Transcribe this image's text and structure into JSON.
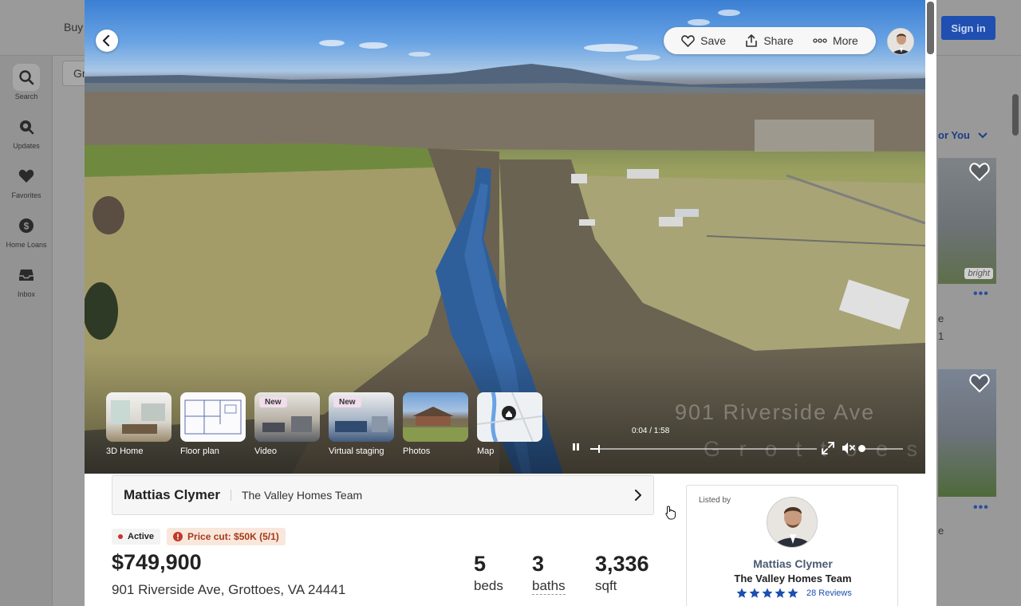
{
  "background": {
    "nav_buy": "Buy",
    "sign_in": "Sign in",
    "search_partial": "Gr",
    "for_you": "or You",
    "card_badge": "bright",
    "card_line_1": "e",
    "card_line_2": "1",
    "card_line_3": "e",
    "sidebar": [
      {
        "label": "Search",
        "icon": "search-icon"
      },
      {
        "label": "Updates",
        "icon": "updates-icon"
      },
      {
        "label": "Favorites",
        "icon": "heart-icon"
      },
      {
        "label": "Home Loans",
        "icon": "dollar-icon"
      },
      {
        "label": "Inbox",
        "icon": "inbox-icon"
      }
    ]
  },
  "toolbar": {
    "save": "Save",
    "share": "Share",
    "more": "More"
  },
  "media": {
    "thumbs": [
      {
        "label": "3D Home",
        "badge": ""
      },
      {
        "label": "Floor plan",
        "badge": ""
      },
      {
        "label": "Video",
        "badge": "New"
      },
      {
        "label": "Virtual staging",
        "badge": "New"
      },
      {
        "label": "Photos",
        "badge": ""
      },
      {
        "label": "Map",
        "badge": ""
      }
    ],
    "watermark": "901 Riverside Ave",
    "watermark_2": "G r o t t o e s",
    "time": "0:04 / 1:58",
    "progress": 0.034,
    "volume": 0.0
  },
  "agent": {
    "name": "Mattias Clymer",
    "team": "The Valley Homes Team"
  },
  "listing": {
    "status": "Active",
    "price_cut": "Price cut: $50K (5/1)",
    "price": "$749,900",
    "address": "901 Riverside Ave, Grottoes, VA 24441",
    "beds": "5",
    "beds_label": "beds",
    "baths": "3",
    "baths_label": "baths",
    "sqft": "3,336",
    "sqft_label": "sqft"
  },
  "listed_card": {
    "label": "Listed by",
    "name": "Mattias Clymer",
    "team": "The Valley Homes Team",
    "reviews": "28 Reviews",
    "rating": 5
  },
  "colors": {
    "accent": "#1d4fb0",
    "price_cut_bg": "#f9e7dc",
    "price_cut_text": "#a33a1a"
  }
}
